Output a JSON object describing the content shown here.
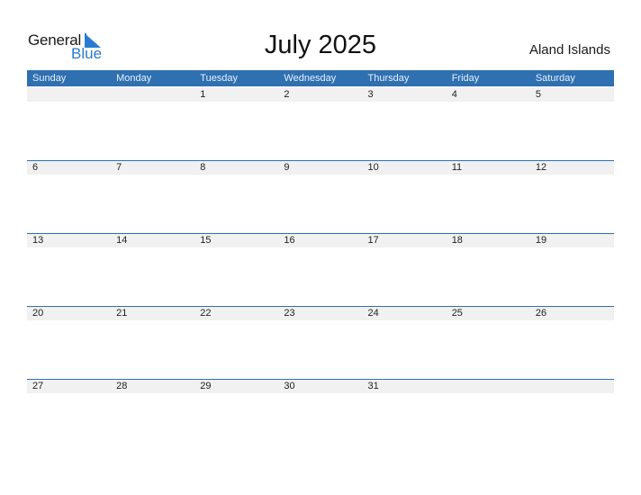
{
  "logo": {
    "line1": "General",
    "line2": "Blue"
  },
  "title": "July 2025",
  "country": "Aland Islands",
  "colors": {
    "accent": "#2f70b1",
    "logo_blue": "#2a7bd0",
    "strip": "#f1f1f1"
  },
  "weekdays": [
    "Sunday",
    "Monday",
    "Tuesday",
    "Wednesday",
    "Thursday",
    "Friday",
    "Saturday"
  ],
  "weeks": [
    [
      "",
      "",
      "1",
      "2",
      "3",
      "4",
      "5"
    ],
    [
      "6",
      "7",
      "8",
      "9",
      "10",
      "11",
      "12"
    ],
    [
      "13",
      "14",
      "15",
      "16",
      "17",
      "18",
      "19"
    ],
    [
      "20",
      "21",
      "22",
      "23",
      "24",
      "25",
      "26"
    ],
    [
      "27",
      "28",
      "29",
      "30",
      "31",
      "",
      ""
    ]
  ]
}
